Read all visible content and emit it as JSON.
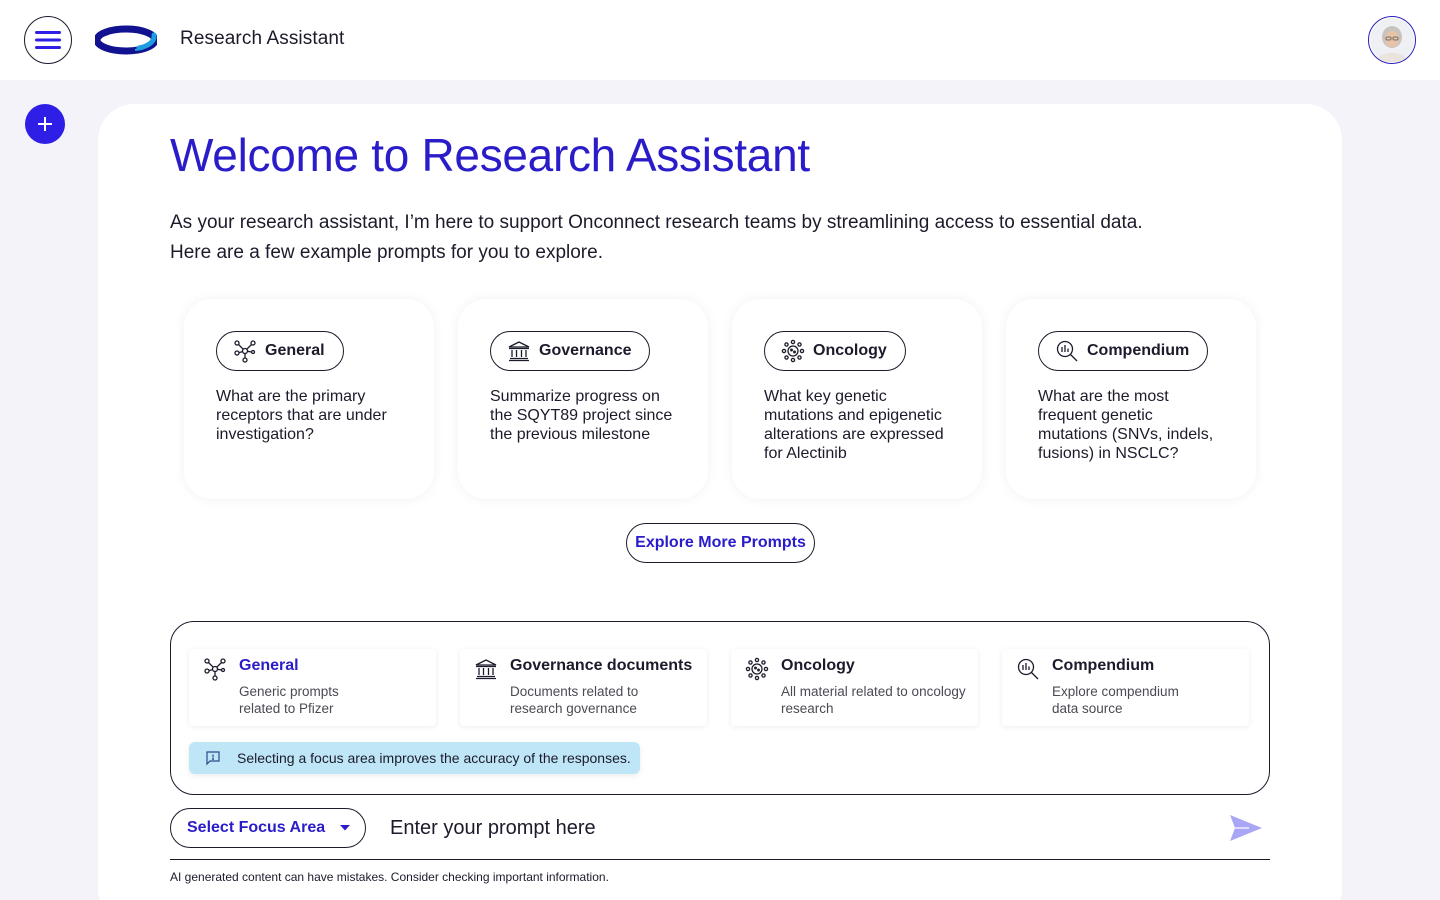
{
  "header": {
    "app_title": "Research Assistant",
    "menu_icon": "hamburger-menu-icon",
    "logo": "brand-logo",
    "avatar": "user-avatar"
  },
  "new_chat_icon": "plus-icon",
  "main": {
    "welcome_title": "Welcome to Research Assistant",
    "intro_line1": "As your research assistant, I’m here to support Onconnect research teams by streamlining access to essential data.",
    "intro_line2": "Here are a few example prompts for you to explore.",
    "prompt_cards": [
      {
        "tag": "General",
        "icon": "molecule-network-icon",
        "text": "What are the primary receptors that are under investigation?"
      },
      {
        "tag": "Governance",
        "icon": "bank-building-icon",
        "text": "Summarize progress on the SQYT89 project since the previous milestone"
      },
      {
        "tag": "Oncology",
        "icon": "cell-virus-icon",
        "text": "What key genetic mutations and epigenetic alterations are expressed for Alectinib"
      },
      {
        "tag": "Compendium",
        "icon": "search-chart-icon",
        "text": "What are the most frequent genetic mutations (SNVs, indels, fusions) in NSCLC?"
      }
    ],
    "explore_button": "Explore More Prompts"
  },
  "focus_panel": {
    "options": [
      {
        "title": "General",
        "desc_line1": "Generic prompts",
        "desc_line2": "related to Pfizer",
        "active": true
      },
      {
        "title": "Governance documents",
        "desc_line1": "Documents related to",
        "desc_line2": "research governance",
        "active": false
      },
      {
        "title": "Oncology",
        "desc_line1": "All material related to oncology",
        "desc_line2": "research",
        "active": false
      },
      {
        "title": "Compendium",
        "desc_line1": "Explore compendium",
        "desc_line2": "data source",
        "active": false
      }
    ],
    "hint": "Selecting a focus area improves the accuracy of the responses."
  },
  "prompt_bar": {
    "select_focus_label": "Select Focus Area",
    "placeholder": "Enter your prompt here",
    "send_icon": "send-icon",
    "disclaimer": "AI generated content can have mistakes. Consider checking important information."
  },
  "colors": {
    "accent": "#2a1cc9",
    "primary_button": "#2f1fe6",
    "hint_bg": "#bfe6f7",
    "page_bg": "#f3f3f9",
    "send_icon": "#a9a6f5"
  }
}
